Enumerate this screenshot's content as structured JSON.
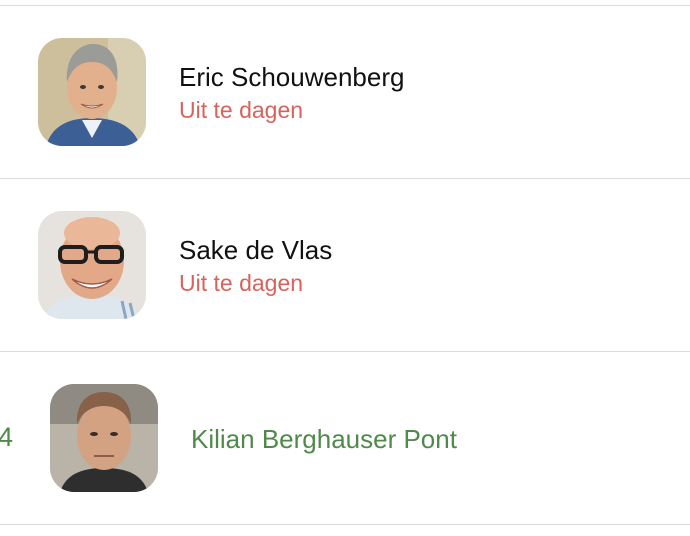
{
  "colors": {
    "status_pending": "#d9625c",
    "highlight_green": "#4f8a4a"
  },
  "contacts": [
    {
      "name": "Eric Schouwenberg",
      "status": "Uit te dagen",
      "avatar_icon": "person-photo"
    },
    {
      "name": "Sake de Vlas",
      "status": "Uit te dagen",
      "avatar_icon": "person-photo"
    },
    {
      "name": "Kilian Berghauser Pont",
      "rank": "4",
      "avatar_icon": "person-photo"
    }
  ]
}
